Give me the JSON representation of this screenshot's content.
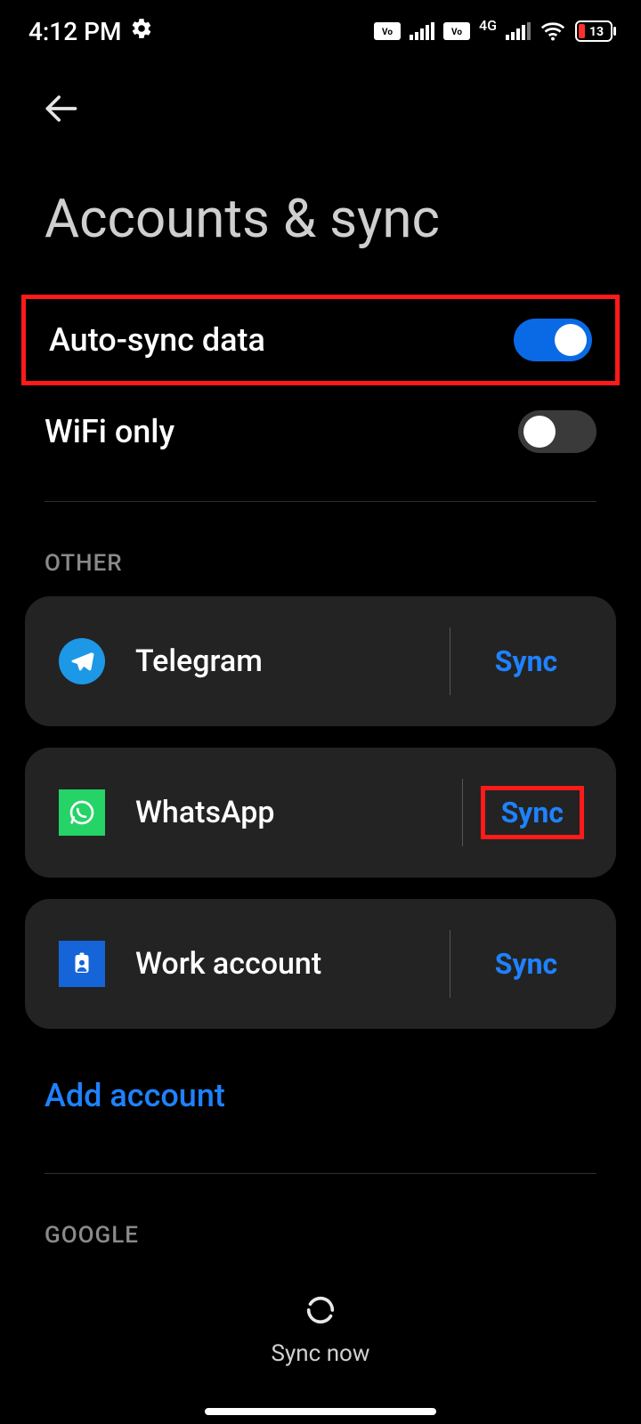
{
  "status": {
    "time": "4:12 PM",
    "battery": "13",
    "network_label": "4G"
  },
  "header": {
    "title": "Accounts & sync"
  },
  "toggles": {
    "autosync": {
      "label": "Auto-sync data",
      "on": true
    },
    "wifi_only": {
      "label": "WiFi only",
      "on": false
    }
  },
  "sections": {
    "other_label": "OTHER",
    "google_label": "GOOGLE"
  },
  "accounts": [
    {
      "name": "Telegram",
      "action": "Sync",
      "icon": "telegram"
    },
    {
      "name": "WhatsApp",
      "action": "Sync",
      "icon": "whatsapp",
      "highlight_action": true
    },
    {
      "name": "Work account",
      "action": "Sync",
      "icon": "work"
    }
  ],
  "add_account_label": "Add account",
  "bottom": {
    "sync_now": "Sync now"
  }
}
